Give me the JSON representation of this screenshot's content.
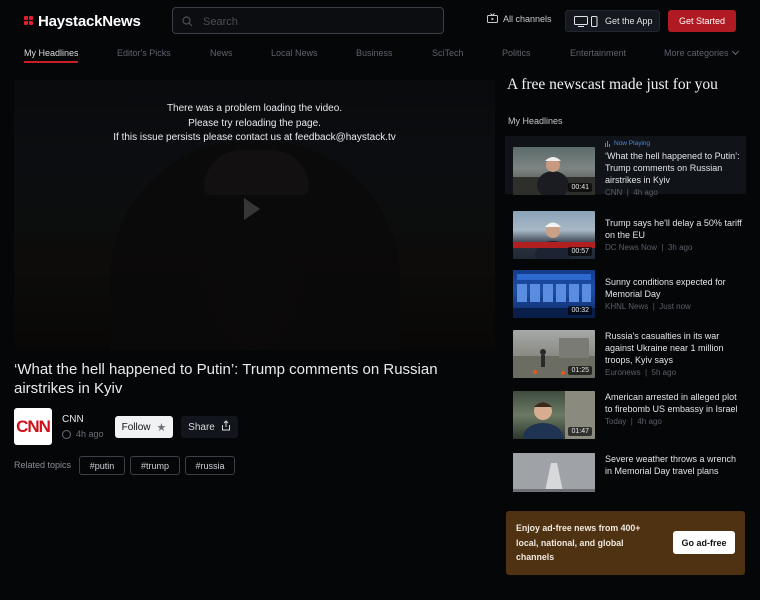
{
  "header": {
    "logo": "HaystackNews",
    "search_placeholder": "Search",
    "all_channels": "All channels",
    "get_app": "Get the App",
    "get_started": "Get Started"
  },
  "nav": {
    "items": [
      "My Headlines",
      "Editor's Picks",
      "News",
      "Local News",
      "Business",
      "SciTech",
      "Politics",
      "Entertainment",
      "More categories"
    ],
    "active": "My Headlines"
  },
  "video": {
    "error_line1": "There was a problem loading the video.",
    "error_line2": "Please try reloading the page.",
    "error_line3": "If this issue persists please contact us at feedback@haystack.tv"
  },
  "story": {
    "title": "‘What the hell happened to Putin’: Trump comments on Russian airstrikes in Kyiv",
    "source_logo": "CNN",
    "source_name": "CNN",
    "time": "4h ago",
    "follow_label": "Follow",
    "share_label": "Share",
    "related_label": "Related topics",
    "tags": [
      "#putin",
      "#trump",
      "#russia"
    ]
  },
  "sidebar": {
    "promo_title": "A free newscast made just for you",
    "section_label": "My Headlines",
    "now_playing": "Now Playing",
    "items": [
      {
        "headline": "‘What the hell happened to Putin’: Trump comments on Russian airstrikes in Kyiv",
        "source": "CNN",
        "time": "4h ago",
        "duration": "00:41",
        "current": true
      },
      {
        "headline": "Trump says he'll delay a 50% tariff on the EU",
        "source": "DC News Now",
        "time": "3h ago",
        "duration": "00:57"
      },
      {
        "headline": "Sunny conditions expected for Memorial Day",
        "source": "KHNL News",
        "time": "Just now",
        "duration": "00:32"
      },
      {
        "headline": "Russia's casualties in its war against Ukraine near 1 million troops, Kyiv says",
        "source": "Euronews",
        "time": "5h ago",
        "duration": "01:25"
      },
      {
        "headline": "American arrested in alleged plot to firebomb US embassy in Israel",
        "source": "Today",
        "time": "4h ago",
        "duration": "01:47"
      },
      {
        "headline": "Severe weather throws a wrench in Memorial Day travel plans",
        "source": "",
        "time": "",
        "duration": ""
      }
    ],
    "ad_text": "Enjoy ad-free news from 400+ local, national, and global channels",
    "ad_button": "Go ad-free"
  }
}
